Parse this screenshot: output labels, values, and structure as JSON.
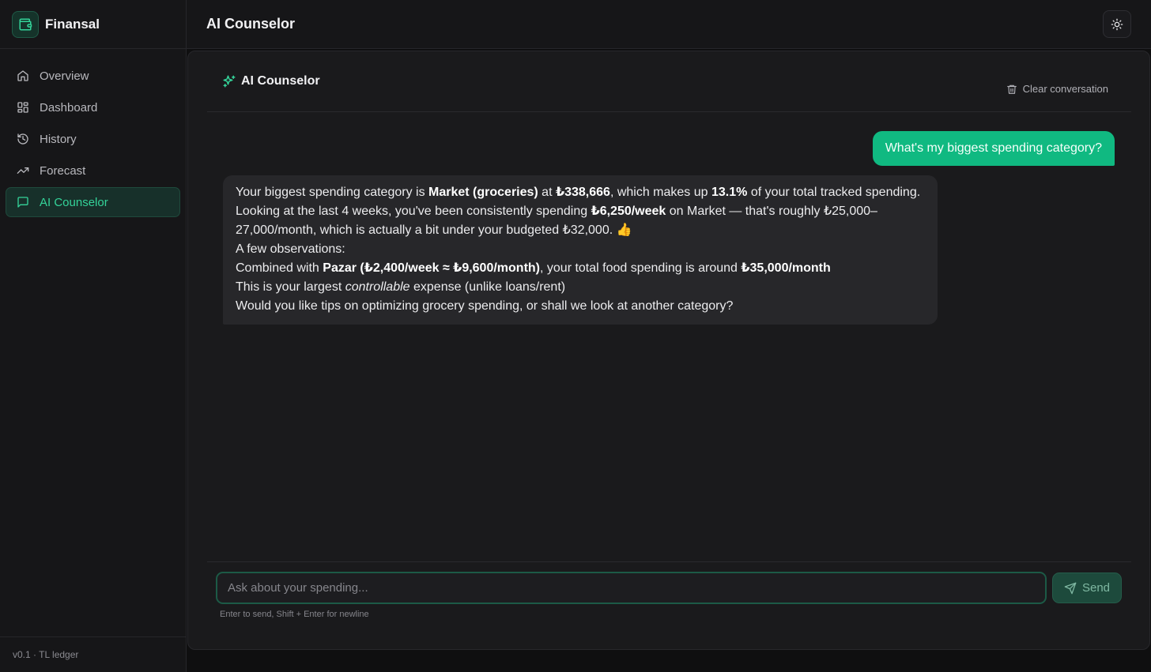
{
  "app": {
    "name": "Finansal",
    "version_label": "v0.1 · TL ledger"
  },
  "sidebar": {
    "items": [
      {
        "label": "Overview",
        "icon": "home-icon",
        "active": false
      },
      {
        "label": "Dashboard",
        "icon": "grid-icon",
        "active": false
      },
      {
        "label": "History",
        "icon": "history-icon",
        "active": false
      },
      {
        "label": "Forecast",
        "icon": "trending-up-icon",
        "active": false
      },
      {
        "label": "AI Counselor",
        "icon": "message-square-icon",
        "active": true
      }
    ]
  },
  "header": {
    "title": "AI Counselor",
    "theme_toggle_icon": "sun-icon"
  },
  "chat": {
    "title": "AI Counselor",
    "clear_label": "Clear conversation",
    "user_message": "What's my biggest spending category?",
    "ai_message": {
      "p1": {
        "t1": "Your biggest spending category is ",
        "b1": "Market (groceries)",
        "t2": " at ",
        "b2": "₺338,666",
        "t3": ", which makes up ",
        "b3": "13.1%",
        "t4": " of your total tracked spending."
      },
      "p2": {
        "t1": "Looking at the last 4 weeks, you've been consistently spending ",
        "b1": "₺6,250/week",
        "t2": " on Market — that's roughly ₺25,000–27,000/month, which is actually a bit under your budgeted ₺32,000. 👍"
      },
      "p3": "A few observations:",
      "p4": {
        "t1": "Combined with ",
        "b1": "Pazar (₺2,400/week ≈ ₺9,600/month)",
        "t2": ", your total food spending is around ",
        "b2": "₺35,000/month"
      },
      "p5": {
        "t1": "This is your largest ",
        "i1": "controllable",
        "t2": " expense (unlike loans/rent)"
      },
      "p6": "Would you like tips on optimizing grocery spending, or shall we look at another category?"
    },
    "input_placeholder": "Ask about your spending...",
    "input_value": "",
    "send_label": "Send",
    "hint": "Enter to send, Shift + Enter for newline"
  },
  "colors": {
    "accent": "#10b981",
    "accent_text": "#34d399",
    "background": "#0f0f10",
    "panel": "#1a1a1c",
    "bubble_ai": "#27272a"
  }
}
